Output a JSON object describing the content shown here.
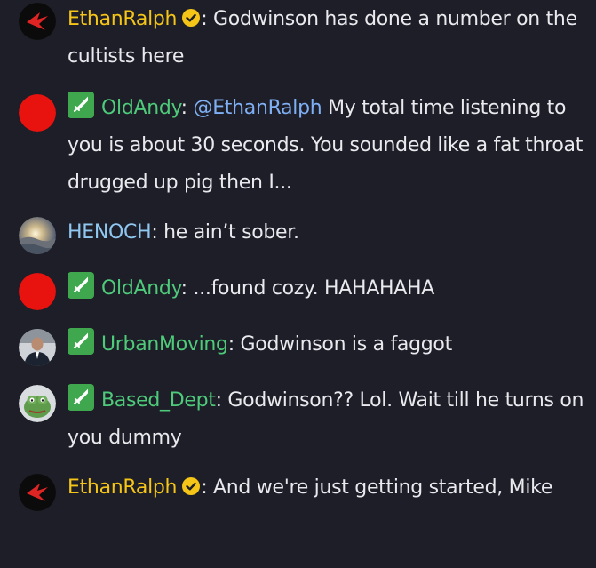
{
  "colors": {
    "background": "#1d1e27",
    "ethan": "#f5c518",
    "mod_green": "#4ecb7a",
    "henoch": "#8fc7f0",
    "mention": "#7fb0f5",
    "badge_green": "#3fa84f"
  },
  "messages": [
    {
      "avatar": "red-logo-avatar",
      "username": "EthanRalph",
      "verified": true,
      "badge": null,
      "colon": ":",
      "mention": "",
      "text": " Godwinson has done a number on the cultists here"
    },
    {
      "avatar": "red-circle-avatar",
      "username": "OldAndy",
      "verified": false,
      "badge": "sword-icon",
      "colon": ":",
      "mention": " @EthanRalph",
      "text": " My total time listening to you is about 30 seconds. You sounded like a fat throat drugged up pig then I..."
    },
    {
      "avatar": "landscape-avatar",
      "username": "HENOCH",
      "verified": false,
      "badge": null,
      "colon": ":",
      "mention": "",
      "text": " he ain’t sober."
    },
    {
      "avatar": "red-circle-avatar",
      "username": "OldAndy",
      "verified": false,
      "badge": "sword-icon",
      "colon": ":",
      "mention": "",
      "text": " ...found cozy. HAHAHAHA"
    },
    {
      "avatar": "person-photo-avatar",
      "username": "UrbanMoving",
      "verified": false,
      "badge": "sword-icon",
      "colon": ":",
      "mention": "",
      "text": " Godwinson is a faggot"
    },
    {
      "avatar": "frog-avatar",
      "username": "Based_Dept",
      "verified": false,
      "badge": "sword-icon",
      "colon": ":",
      "mention": "",
      "text": " Godwinson?? Lol. Wait till he turns on you dummy"
    },
    {
      "avatar": "red-logo-avatar",
      "username": "EthanRalph",
      "verified": true,
      "badge": null,
      "colon": ":",
      "mention": "",
      "text": " And we're just getting started, Mike"
    }
  ]
}
